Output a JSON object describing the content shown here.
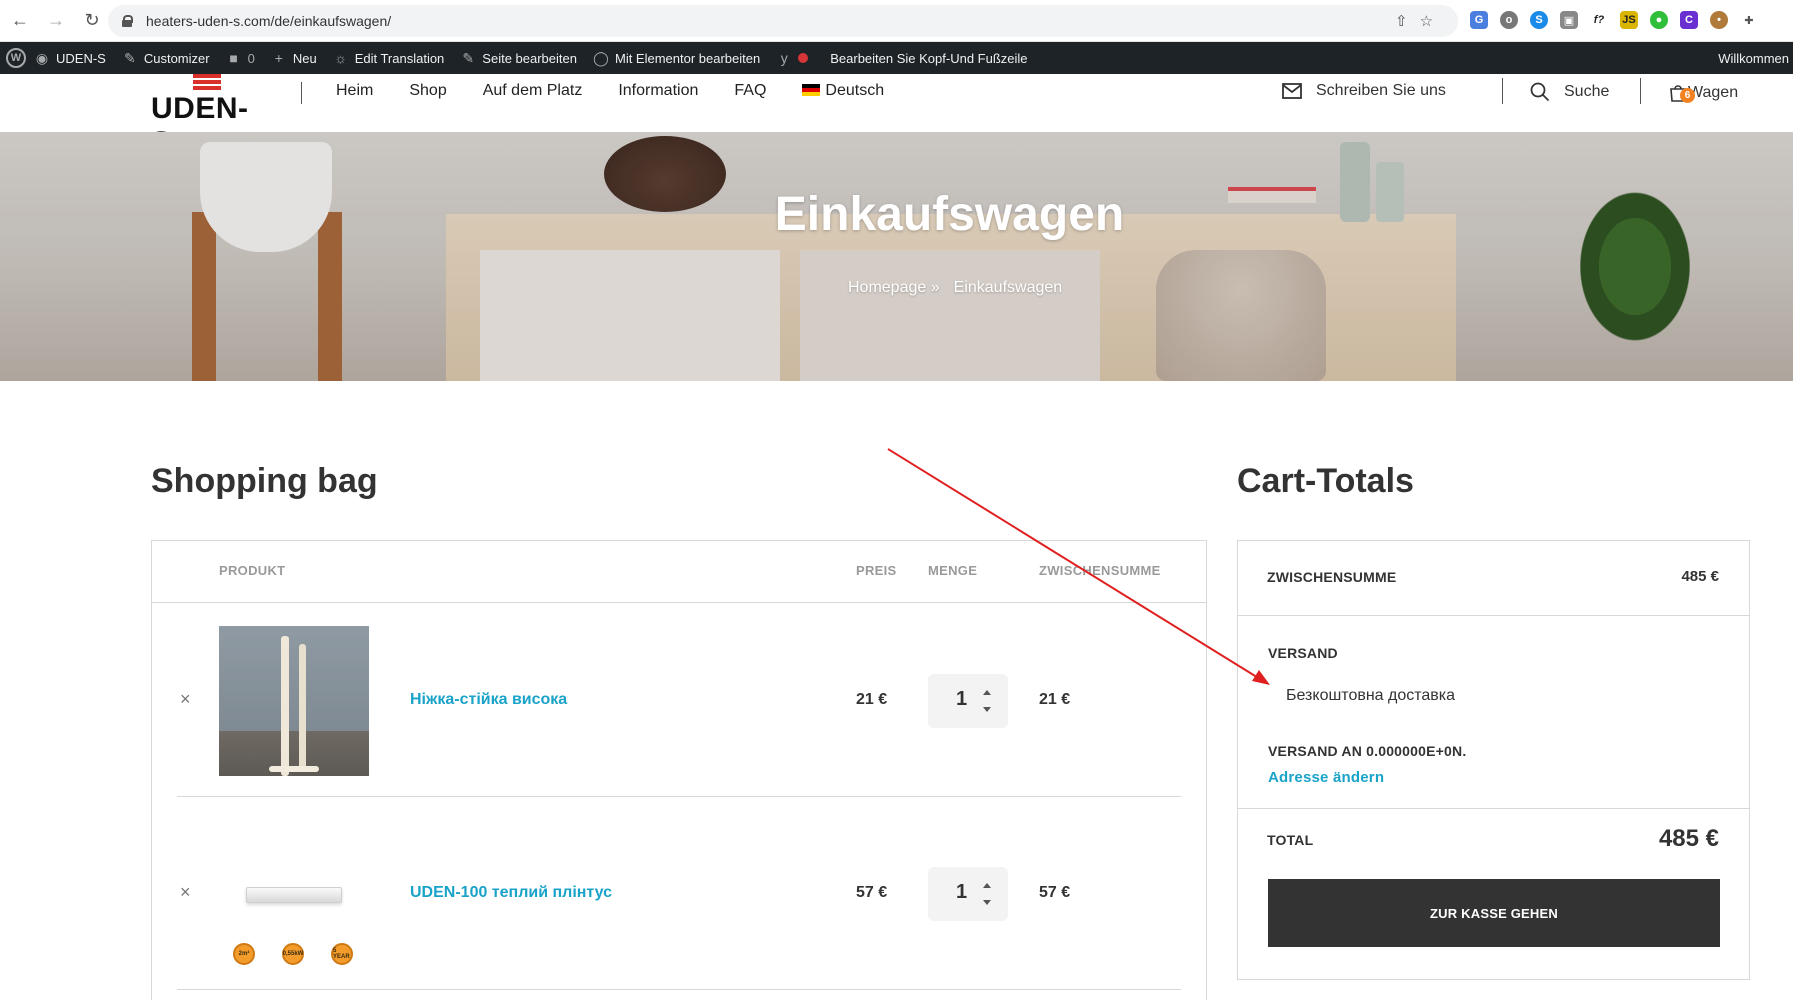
{
  "browser": {
    "url": "heaters-uden-s.com/de/einkaufswagen/"
  },
  "admin_bar": {
    "site_name": "UDEN-S",
    "customizer": "Customizer",
    "comments_count": "0",
    "new": "Neu",
    "edit_translation": "Edit Translation",
    "edit_page": "Seite bearbeiten",
    "elementor": "Mit Elementor bearbeiten",
    "header_footer": "Bearbeiten Sie Kopf-Und Fußzeile",
    "welcome": "Willkommen"
  },
  "header": {
    "logo_text": "UDEN-S",
    "nav": [
      "Heim",
      "Shop",
      "Auf dem Platz",
      "Information",
      "FAQ"
    ],
    "language": "Deutsch",
    "contact": "Schreiben Sie uns",
    "search": "Suche",
    "cart_label": "Wagen",
    "cart_count": "6"
  },
  "hero": {
    "title": "Einkaufswagen",
    "breadcrumb_home": "Homepage",
    "breadcrumb_sep": "»",
    "breadcrumb_current": "Einkaufswagen"
  },
  "cart": {
    "title": "Shopping bag",
    "columns": {
      "product": "PRODUKT",
      "price": "PREIS",
      "quantity": "MENGE",
      "subtotal": "ZWISCHENSUMME"
    },
    "remove_symbol": "×",
    "items": [
      {
        "name": "Ніжка-стійка висока",
        "price": "21 €",
        "quantity": "1",
        "subtotal": "21 €"
      },
      {
        "name": "UDEN-100 теплий плінтус",
        "price": "57 €",
        "quantity": "1",
        "subtotal": "57 €"
      }
    ],
    "badges": [
      "2m²",
      "0,55kW",
      "5 YEAR"
    ]
  },
  "totals": {
    "title": "Cart-Totals",
    "subtotal_label": "ZWISCHENSUMME",
    "subtotal_value": "485 €",
    "shipping_label": "VERSAND",
    "shipping_method": "Безкоштовна доставка",
    "shipping_to": "VERSAND AN 0.000000E+0N.",
    "change_address": "Adresse ändern",
    "total_label": "TOTAL",
    "total_value": "485 €",
    "checkout_button": "ZUR KASSE GEHEN"
  },
  "colors": {
    "accent": "#1aa3c8",
    "admin_bar": "#1d2327",
    "checkout_button": "#333333",
    "cart_badge": "#f58220",
    "annotation_arrow": "#e02020"
  }
}
